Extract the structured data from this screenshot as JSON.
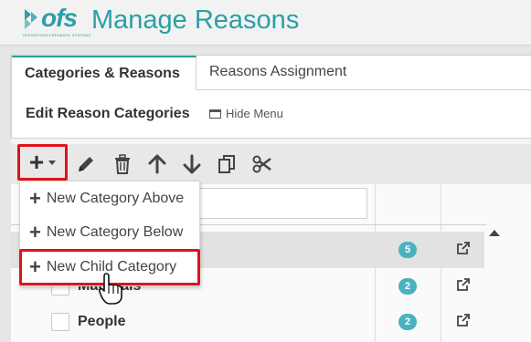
{
  "app": {
    "logo_text": "ofs",
    "logo_tagline": "OPERATIONS FEEDBACK SYSTEMS",
    "title": "Manage Reasons",
    "accent_color": "#2a9fa7"
  },
  "tabs": [
    {
      "label": "Categories & Reasons",
      "active": true
    },
    {
      "label": "Reasons Assignment",
      "active": false
    }
  ],
  "panel": {
    "heading": "Edit Reason Categories",
    "hide_menu_label": "Hide Menu"
  },
  "toolbar": {
    "add": {
      "symbol": "+",
      "icon": "plus-dropdown-icon"
    },
    "edit": {
      "symbol": "✎",
      "icon": "pencil-icon"
    },
    "delete": {
      "symbol": "🗑",
      "icon": "trash-icon"
    },
    "up": {
      "symbol": "↑",
      "icon": "arrow-up-icon"
    },
    "down": {
      "symbol": "↓",
      "icon": "arrow-down-icon"
    },
    "copy": {
      "symbol": "⧉",
      "icon": "copy-icon"
    },
    "cut": {
      "symbol": "✂",
      "icon": "scissors-icon"
    }
  },
  "dropdown": {
    "items": [
      {
        "label": "New Category Above"
      },
      {
        "label": "New Category Below"
      },
      {
        "label": "New Child Category"
      }
    ],
    "plus_symbol": "+"
  },
  "rows": [
    {
      "label": "",
      "count": "5"
    },
    {
      "label": "Materials",
      "count": "2"
    },
    {
      "label": "People",
      "count": "2"
    }
  ],
  "colors": {
    "highlight_border": "#e0121b",
    "badge": "#4ab2c0"
  }
}
